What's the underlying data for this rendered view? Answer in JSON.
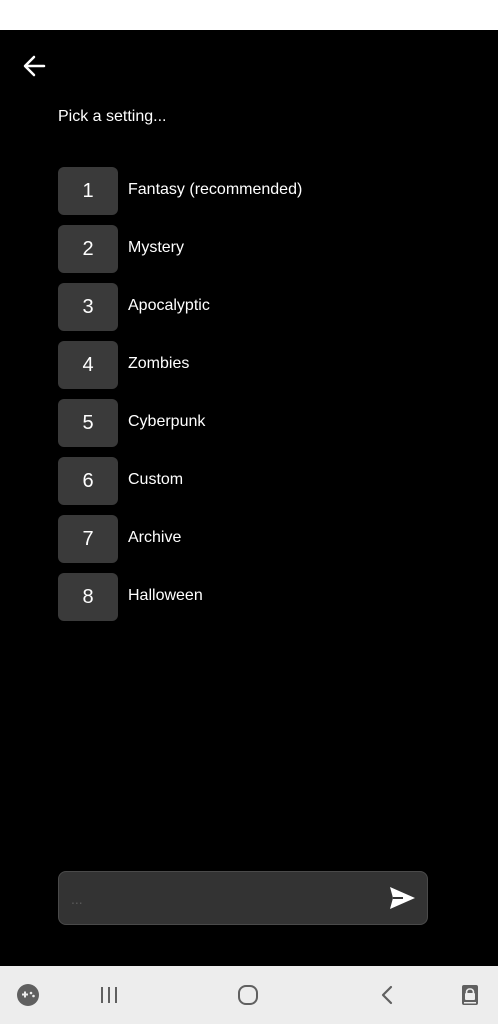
{
  "screen": {
    "prompt": "Pick a setting...",
    "options": [
      {
        "number": "1",
        "label": "Fantasy (recommended)"
      },
      {
        "number": "2",
        "label": "Mystery"
      },
      {
        "number": "3",
        "label": "Apocalyptic"
      },
      {
        "number": "4",
        "label": "Zombies"
      },
      {
        "number": "5",
        "label": "Cyberpunk"
      },
      {
        "number": "6",
        "label": "Custom"
      },
      {
        "number": "7",
        "label": "Archive"
      },
      {
        "number": "8",
        "label": "Halloween"
      }
    ]
  },
  "input": {
    "placeholder": "..."
  },
  "icons": {
    "back": "arrow-left-icon",
    "send": "send-icon",
    "nav": [
      "gamepad-icon",
      "recent-apps-icon",
      "home-icon",
      "back-chevron-icon",
      "lock-icon"
    ]
  },
  "colors": {
    "background": "#000000",
    "button": "#3a3a3a",
    "input": "#333333",
    "nav_bar": "#ededed"
  }
}
